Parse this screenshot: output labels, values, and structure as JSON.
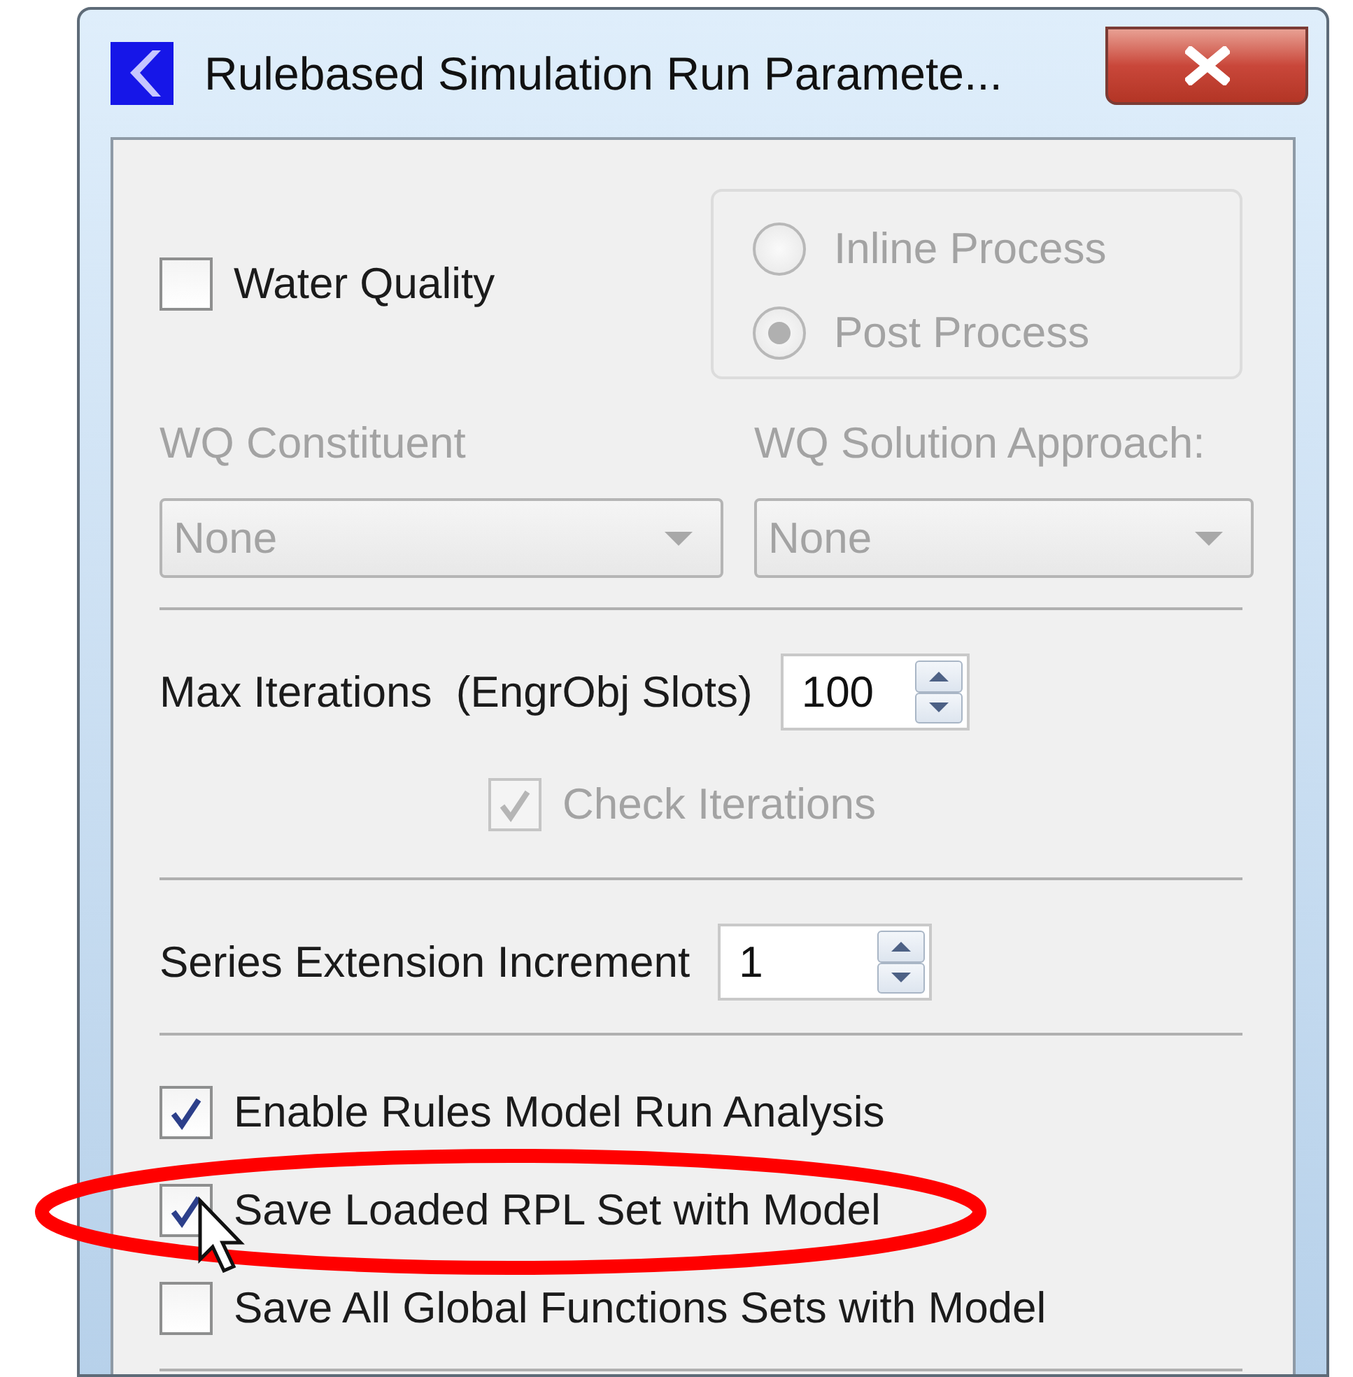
{
  "window": {
    "title": "Rulebased Simulation Run Paramete..."
  },
  "water_quality": {
    "label": "Water Quality",
    "checked": false
  },
  "process_options": [
    {
      "label": "Inline Process",
      "selected": false,
      "disabled": true
    },
    {
      "label": "Post Process",
      "selected": true,
      "disabled": true
    }
  ],
  "wq_constituent": {
    "label": "WQ Constituent",
    "value": "None",
    "disabled": true
  },
  "wq_solution_approach": {
    "label": "WQ Solution Approach:",
    "value": "None",
    "disabled": true
  },
  "max_iterations": {
    "label": "Max Iterations  (EngrObj Slots)",
    "value": "100"
  },
  "check_iterations": {
    "label": "Check Iterations",
    "checked": true,
    "disabled": true
  },
  "series_extension_increment": {
    "label": "Series Extension Increment",
    "value": "1"
  },
  "options": [
    {
      "label": "Enable Rules Model Run Analysis",
      "checked": true
    },
    {
      "label": "Save Loaded RPL Set with Model",
      "checked": true
    },
    {
      "label": "Save All Global Functions Sets with Model",
      "checked": false
    }
  ]
}
